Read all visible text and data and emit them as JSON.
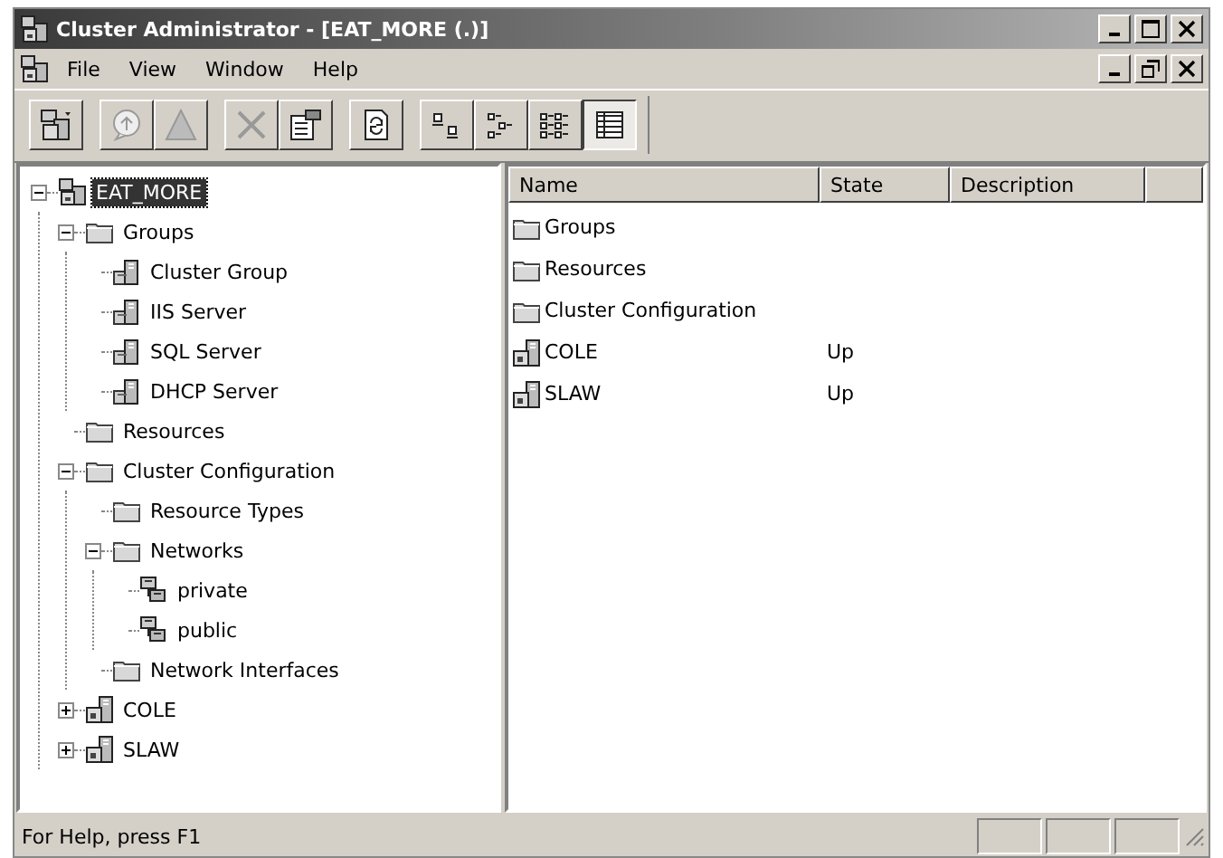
{
  "window": {
    "title": "Cluster Administrator - [EAT_MORE (.)]"
  },
  "menu": [
    {
      "label": "File"
    },
    {
      "label": "View"
    },
    {
      "label": "Window"
    },
    {
      "label": "Help"
    }
  ],
  "toolbar": [
    {
      "kind": "open-connection",
      "disabled": false,
      "pressed": false
    },
    {
      "kind": "separator"
    },
    {
      "kind": "bring-online",
      "disabled": true,
      "pressed": false
    },
    {
      "kind": "take-offline",
      "disabled": true,
      "pressed": false
    },
    {
      "kind": "separator"
    },
    {
      "kind": "delete",
      "disabled": true,
      "pressed": false
    },
    {
      "kind": "properties",
      "disabled": false,
      "pressed": false
    },
    {
      "kind": "separator"
    },
    {
      "kind": "refresh",
      "disabled": false,
      "pressed": false
    },
    {
      "kind": "separator"
    },
    {
      "kind": "large-icons",
      "disabled": false,
      "pressed": false
    },
    {
      "kind": "small-icons",
      "disabled": false,
      "pressed": false
    },
    {
      "kind": "list",
      "disabled": false,
      "pressed": false
    },
    {
      "kind": "details",
      "disabled": false,
      "pressed": true
    }
  ],
  "tree": [
    {
      "label": "EAT_MORE",
      "kind": "cluster",
      "selected": true,
      "expanded": true,
      "children": [
        {
          "label": "Groups",
          "kind": "folder",
          "selected": false,
          "expanded": true,
          "children": [
            {
              "label": "Cluster Group",
              "kind": "group",
              "selected": false
            },
            {
              "label": "IIS Server",
              "kind": "group",
              "selected": false
            },
            {
              "label": "SQL Server",
              "kind": "group",
              "selected": false
            },
            {
              "label": "DHCP Server",
              "kind": "group",
              "selected": false
            }
          ]
        },
        {
          "label": "Resources",
          "kind": "folder",
          "selected": false
        },
        {
          "label": "Cluster Configuration",
          "kind": "folder",
          "selected": false,
          "expanded": true,
          "children": [
            {
              "label": "Resource Types",
              "kind": "folder",
              "selected": false
            },
            {
              "label": "Networks",
              "kind": "folder",
              "selected": false,
              "expanded": true,
              "children": [
                {
                  "label": "private",
                  "kind": "network",
                  "selected": false
                },
                {
                  "label": "public",
                  "kind": "network",
                  "selected": false
                }
              ]
            },
            {
              "label": "Network Interfaces",
              "kind": "folder",
              "selected": false
            }
          ]
        },
        {
          "label": "COLE",
          "kind": "node",
          "selected": false,
          "expanded": false
        },
        {
          "label": "SLAW",
          "kind": "node",
          "selected": false,
          "expanded": false
        }
      ]
    }
  ],
  "list": {
    "columns": [
      "Name",
      "State",
      "Description"
    ],
    "rows": [
      {
        "name": "Groups",
        "kind": "folder"
      },
      {
        "name": "Resources",
        "kind": "folder"
      },
      {
        "name": "Cluster Configuration",
        "kind": "folder"
      },
      {
        "name": "COLE",
        "kind": "node",
        "state": "Up"
      },
      {
        "name": "SLAW",
        "kind": "node",
        "state": "Up"
      }
    ]
  },
  "status_bar": {
    "text": "For Help, press F1"
  }
}
